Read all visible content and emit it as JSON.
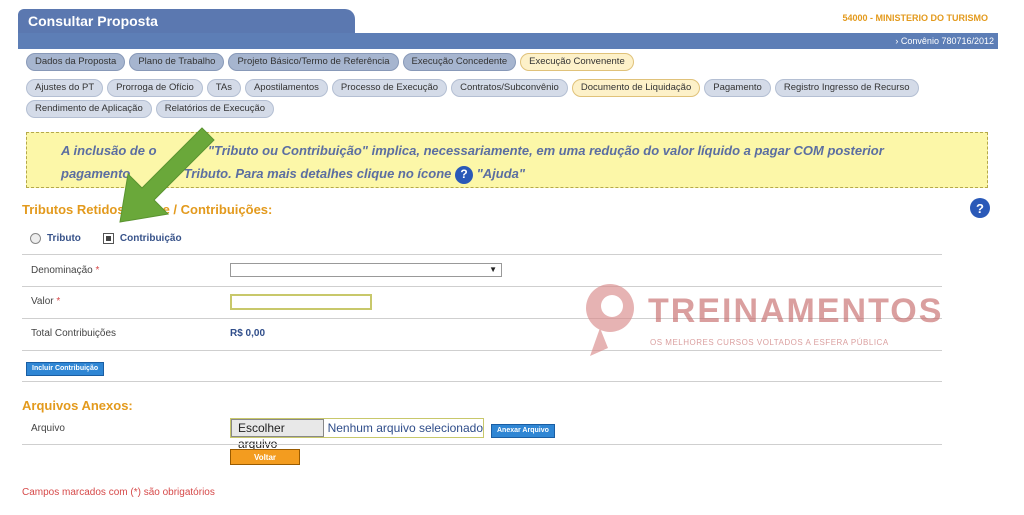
{
  "header": {
    "title": "Consultar Proposta",
    "org": "54000 - MINISTERIO DO TURISMO",
    "convenio": "› Convênio 780716/2012"
  },
  "tabs_primary": [
    {
      "label": "Dados da Proposta"
    },
    {
      "label": "Plano de Trabalho"
    },
    {
      "label": "Projeto Básico/Termo de Referência"
    },
    {
      "label": "Execução Concedente"
    },
    {
      "label": "Execução Convenente"
    }
  ],
  "tabs_secondary_row1": [
    {
      "label": "Ajustes do PT"
    },
    {
      "label": "Prorroga de Ofício"
    },
    {
      "label": "TAs"
    },
    {
      "label": "Apostilamentos"
    },
    {
      "label": "Processo de Execução"
    },
    {
      "label": "Contratos/Subconvênio"
    },
    {
      "label": "Documento de Liquidação"
    },
    {
      "label": "Pagamento"
    },
    {
      "label": "Registro Ingresso de Recurso"
    }
  ],
  "tabs_secondary_row2": [
    {
      "label": "Rendimento de Aplicação"
    },
    {
      "label": "Relatórios de Execução"
    }
  ],
  "notice": {
    "line1": "A inclusão de o",
    "line1_b": "\"Tributo ou Contribuição\" implica, necessariamente, em uma redução do valor líquido a pagar COM posterior",
    "line2_a": "pagamento",
    "line2_b": "Tributo. Para mais detalhes clique no ícone",
    "line2_c": "\"Ajuda\""
  },
  "section_tributos": {
    "title_a": "Tributos Retidos",
    "title_b": "e / Contribuições:",
    "option_tributo": "Tributo",
    "option_contribuicao": "Contribuição",
    "denominacao_label": "Denominação",
    "valor_label": "Valor",
    "required_mark": "*",
    "total_label": "Total Contribuições",
    "total_value": "R$ 0,00",
    "incluir_button": "Incluir Contribuição"
  },
  "section_arquivos": {
    "title": "Arquivos Anexos:",
    "arquivo_label": "Arquivo",
    "file_button": "Escolher arquivo",
    "file_status": "Nenhum arquivo selecionado",
    "anexar_button": "Anexar Arquivo"
  },
  "voltar_button": "Voltar",
  "footer_note": "Campos marcados com (*) são obrigatórios",
  "help_glyph": "?",
  "select_arrow": "▼",
  "watermark": {
    "text": "TREINAMENTOS",
    "sub": "OS MELHORES CURSOS VOLTADOS A ESFERA PÚBLICA"
  },
  "colors": {
    "header_blue": "#5b78b0",
    "orange": "#e39a1d",
    "notice_bg": "#fcf7a8",
    "arrow_green": "#6aa83a"
  }
}
